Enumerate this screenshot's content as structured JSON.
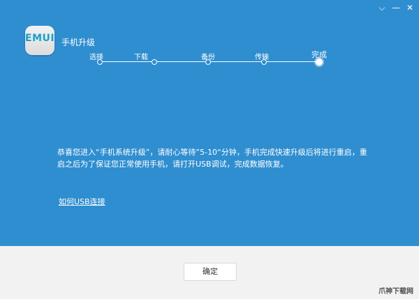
{
  "window": {
    "controls": {
      "menu_icon": "chevron-down-icon",
      "minimize_icon": "minimize-icon",
      "close_icon": "close-icon",
      "menu_glyph": "⌵",
      "minimize_glyph": "—",
      "close_glyph": "✕"
    }
  },
  "app": {
    "logo_text": "EMUI",
    "title": "手机升级"
  },
  "steps": [
    {
      "label": "选择",
      "state": "done"
    },
    {
      "label": "下载",
      "state": "done"
    },
    {
      "label": "备份",
      "state": "done"
    },
    {
      "label": "传输",
      "state": "done"
    },
    {
      "label": "完成",
      "state": "current"
    }
  ],
  "main": {
    "message": "恭喜您进入“手机系统升级”，请耐心等待”5-10“分钟，手机完成快速升级后将进行重启，重启之后为了保证您正常使用手机，请打开USB调试，完成数据恢复。",
    "help_link": "如何USB连接"
  },
  "footer": {
    "confirm_label": "确定"
  },
  "watermark": "爪神下载网",
  "colors": {
    "primary_bg": "#2f8ed0",
    "footer_bg": "#f2f2f2",
    "text_on_primary": "#ffffff"
  }
}
